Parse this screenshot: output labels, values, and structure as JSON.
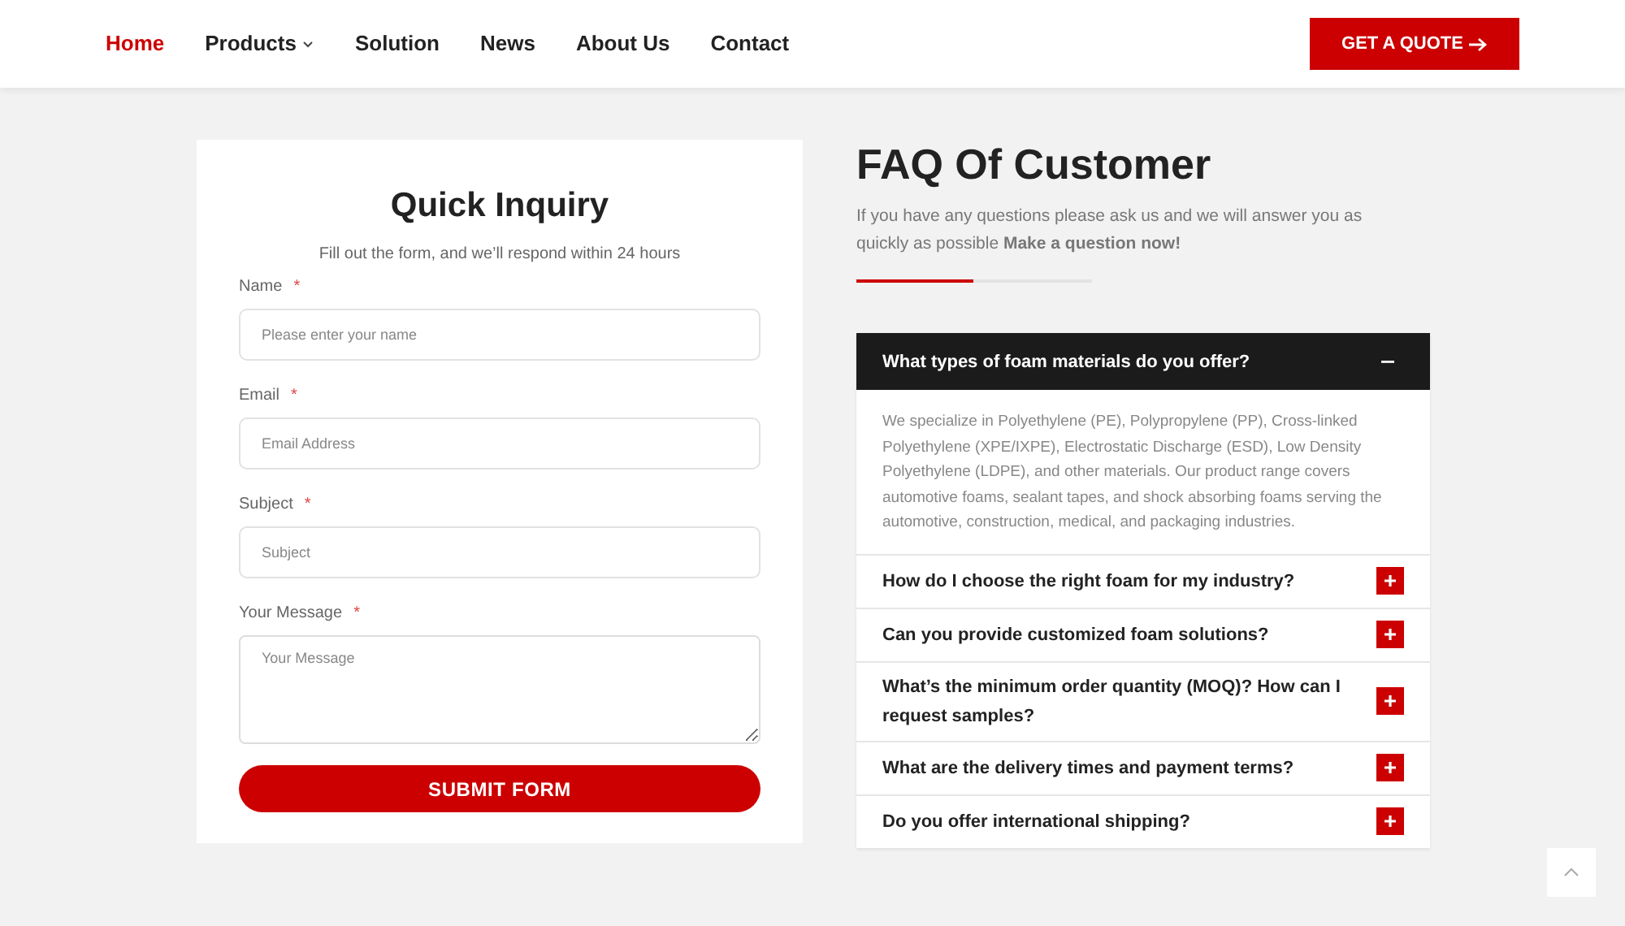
{
  "nav": {
    "items": [
      {
        "label": "Home",
        "selected": true,
        "dropdown": false
      },
      {
        "label": "Products",
        "selected": false,
        "dropdown": true
      },
      {
        "label": "Solution",
        "selected": false,
        "dropdown": false
      },
      {
        "label": "News",
        "selected": false,
        "dropdown": false
      },
      {
        "label": "About Us",
        "selected": false,
        "dropdown": false
      },
      {
        "label": "Contact",
        "selected": false,
        "dropdown": false
      }
    ],
    "cta": "GET A QUOTE"
  },
  "form": {
    "title": "Quick Inquiry",
    "subtitle": "Fill out the form, and we’ll respond within 24 hours",
    "fields": [
      {
        "kind": "input",
        "label": "Name",
        "marker": "*",
        "placeholder": "Please enter your name"
      },
      {
        "kind": "input",
        "label": "Email",
        "marker": "*",
        "placeholder": "Email Address"
      },
      {
        "kind": "input",
        "label": "Subject",
        "marker": "*",
        "placeholder": "Subject"
      },
      {
        "kind": "textarea",
        "label": "Your Message",
        "marker": "*",
        "placeholder": "Your Message"
      }
    ],
    "submit": "SUBMIT FORM"
  },
  "faq": {
    "title": "FAQ Of Customer",
    "intro": "If you have any questions please ask us and we will answer you as quickly as possible **Make a question now!**",
    "items": [
      {
        "question": "What types of foam materials do you offer?",
        "expanded": true,
        "answer": "We specialize in Polyethylene (PE), Polypropylene (PP), Cross-linked Polyethylene (XPE/IXPE), Electrostatic Discharge (ESD), Low Density Polyethylene (LDPE), and other materials. Our product range covers automotive foams, sealant tapes, and shock absorbing foams serving the automotive, construction, medical, and packaging industries."
      },
      {
        "question": "How do I choose the right foam for my industry?",
        "expanded": false
      },
      {
        "question": "Can you provide customized foam solutions?",
        "expanded": false
      },
      {
        "question": "What’s the minimum order quantity (MOQ)? How can I request samples?",
        "expanded": false
      },
      {
        "question": "What are the delivery times and payment terms?",
        "expanded": false
      },
      {
        "question": "Do you offer international shipping?",
        "expanded": false
      }
    ]
  }
}
